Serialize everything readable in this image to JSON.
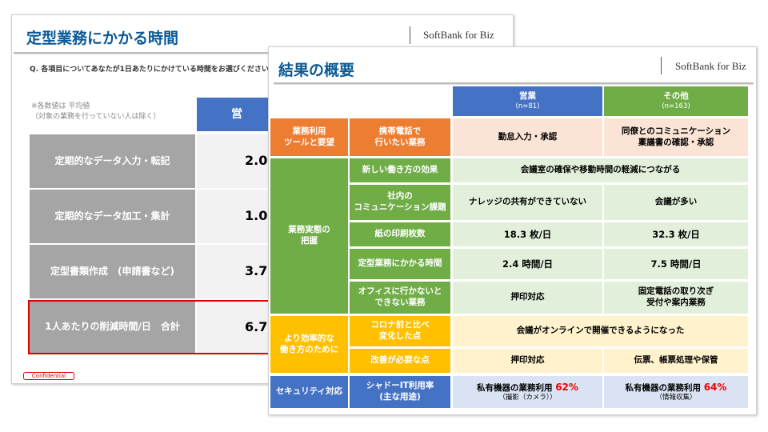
{
  "back": {
    "title": "定型業務にかかる時間",
    "brand": "SoftBank for Biz",
    "question": "Q. 各項目についてあなたが1日あたりにかけている時間をお選びください。",
    "note": "※各数値は 平均値\n（対象の業務を行っていない人は除く）",
    "header": "営",
    "rows": [
      {
        "label": "定期的なデータ入力・転記",
        "value": "2.0"
      },
      {
        "label": "定期的なデータ加工・集計",
        "value": "1.0"
      },
      {
        "label": "定型書類作成　(申請書など)",
        "value": "3.7"
      },
      {
        "label": "1人あたりの削減時間/日　合計",
        "value": "6.7"
      }
    ],
    "confidential": "Confidential"
  },
  "front": {
    "title": "結果の概要",
    "brand": "SoftBank for Biz",
    "col_sales": "営業",
    "col_sales_n": "(n=81)",
    "col_other": "その他",
    "col_other_n": "(n=163)",
    "g1": "業務利用\nツールと要望",
    "r1": {
      "label": "携帯電話で\n行いたい業務",
      "sales": "勤怠入力・承認",
      "other": "同僚とのコミュニケーション\n稟議書の確認・承認"
    },
    "g2": "業務実態の\n把握",
    "r2": {
      "label": "新しい働き方の効果",
      "both": "会議室の確保や移動時間の軽減につながる"
    },
    "r3": {
      "label": "社内の\nコミュニケーション課題",
      "sales": "ナレッジの共有ができていない",
      "other": "会議が多い"
    },
    "r4": {
      "label": "紙の印刷枚数",
      "sales": "18.3 枚/日",
      "other": "32.3 枚/日"
    },
    "r5": {
      "label": "定型業務にかかる時間",
      "sales": "2.4 時間/日",
      "other": "7.5 時間/日"
    },
    "r6": {
      "label": "オフィスに行かないと\nできない業務",
      "sales": "押印対応",
      "other": "固定電話の取り次ぎ\n受付や案内業務"
    },
    "g3": "より効率的な\n働き方のために",
    "r7": {
      "label": "コロナ前と比べ\n変化した点",
      "both": "会議がオンラインで開催できるようになった"
    },
    "r8": {
      "label": "改善が必要な点",
      "sales": "押印対応",
      "other": "伝票、帳票処理や保管"
    },
    "g4": "セキュリティ対応",
    "r9": {
      "label": "シャドーIT利用率\n(主な用途)",
      "sales": "私有機器の業務利用 ",
      "sales_pct": "62%",
      "sales_sub": "（撮影（カメラ））",
      "other": "私有機器の業務利用 ",
      "other_pct": "64%",
      "other_sub": "（情報収集）"
    }
  },
  "colors": {
    "blue": "#4472c4",
    "green": "#70ad47",
    "orange": "#ed7d31",
    "yellow": "#ffc000",
    "title": "#0a5a96",
    "red": "#e00000"
  }
}
